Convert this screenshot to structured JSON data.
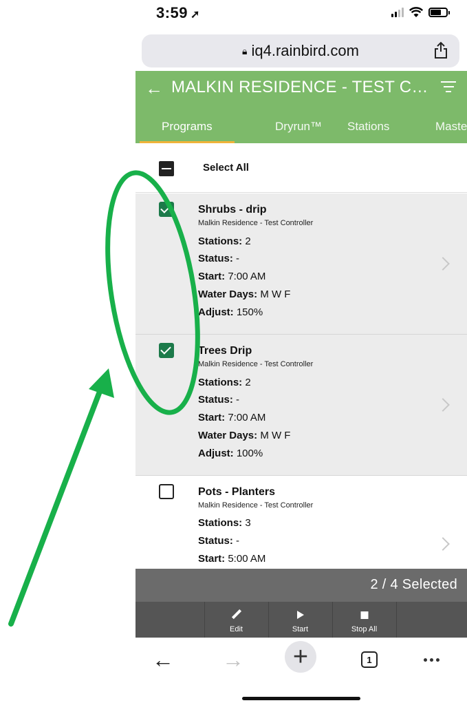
{
  "status_bar": {
    "time": "3:59",
    "location_glyph": "➚"
  },
  "browser": {
    "url": "iq4.rainbird.com"
  },
  "app_header": {
    "back_glyph": "←",
    "title": "MALKIN RESIDENCE - TEST CONT...",
    "tabs": [
      {
        "label": "Programs",
        "active": true
      },
      {
        "label": "Dryrun™",
        "active": false
      },
      {
        "label": "Stations",
        "active": false
      },
      {
        "label": "Maste",
        "active": false
      }
    ],
    "accent_color": "#7dba6a",
    "tab_indicator_color": "#f0b33a"
  },
  "list": {
    "select_all_label": "Select All",
    "labels": {
      "stations": "Stations:",
      "status": "Status:",
      "start": "Start:",
      "water_days": "Water Days:",
      "adjust": "Adjust:"
    },
    "programs": [
      {
        "name": "Shrubs - drip",
        "controller": "Malkin Residence - Test Controller",
        "checked": true,
        "stations": "2",
        "status": "-",
        "start": "7:00 AM",
        "water_days": "M W F",
        "adjust": "150%"
      },
      {
        "name": "Trees Drip",
        "controller": "Malkin Residence - Test Controller",
        "checked": true,
        "stations": "2",
        "status": "-",
        "start": "7:00 AM",
        "water_days": "M W F",
        "adjust": "100%"
      },
      {
        "name": "Pots - Planters",
        "controller": "Malkin Residence - Test Controller",
        "checked": false,
        "stations": "3",
        "status": "-",
        "start": "5:00 AM"
      }
    ]
  },
  "selection_bar": {
    "count_text": "2 / 4 Selected"
  },
  "actions": [
    {
      "label": "Edit",
      "icon": "pencil-icon"
    },
    {
      "label": "Start",
      "icon": "play-icon"
    },
    {
      "label": "Stop All",
      "icon": "stop-icon"
    }
  ],
  "browser_toolbar": {
    "back": "←",
    "forward": "→",
    "new_tab": "+",
    "tab_count": "1"
  },
  "annotation": {
    "color": "#18b04a"
  }
}
